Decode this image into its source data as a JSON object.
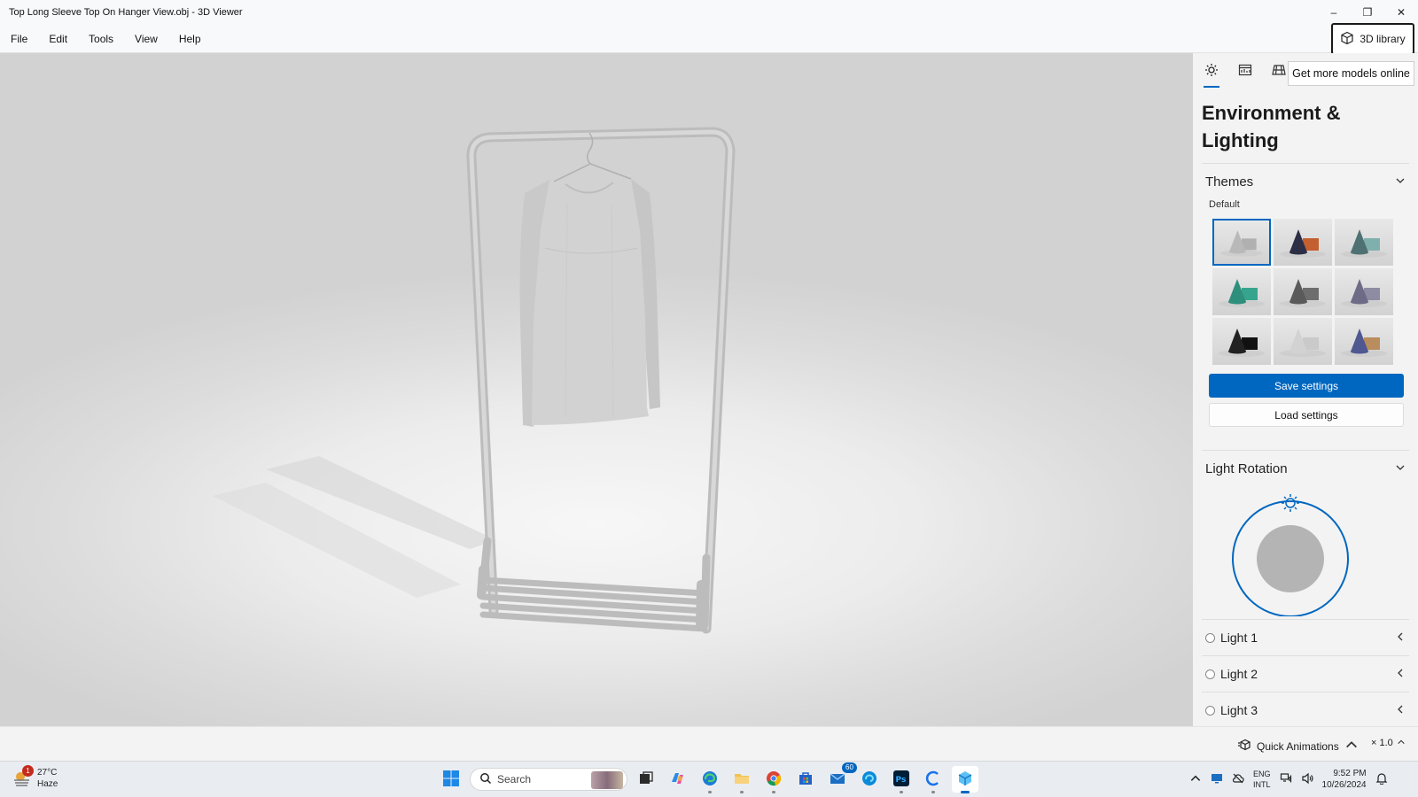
{
  "window": {
    "title": "Top Long Sleeve Top On Hanger View.obj - 3D Viewer",
    "minimize": "–",
    "restore": "❐",
    "close": "✕"
  },
  "menu": {
    "items": [
      "File",
      "Edit",
      "Tools",
      "View",
      "Help"
    ],
    "library_button": "3D library"
  },
  "panel": {
    "tooltip": "Get more models online",
    "title": "Environment & Lighting",
    "themes_label": "Themes",
    "default_label": "Default",
    "themes": [
      {
        "name": "default-gray",
        "cone": "#b9b9b9",
        "box": "#b0b0b0",
        "selected": true
      },
      {
        "name": "dark-orange",
        "cone": "#2c2f45",
        "box": "#c4602f",
        "selected": false
      },
      {
        "name": "teal-gray",
        "cone": "#4f7173",
        "box": "#7fb0ad",
        "selected": false
      },
      {
        "name": "green",
        "cone": "#2f8f7d",
        "box": "#37a58d",
        "selected": false
      },
      {
        "name": "dark-gray",
        "cone": "#5a5a5a",
        "box": "#6e6e6e",
        "selected": false
      },
      {
        "name": "purple-gray",
        "cone": "#6d6b86",
        "box": "#8e8ca3",
        "selected": false
      },
      {
        "name": "black",
        "cone": "#222222",
        "box": "#111111",
        "selected": false
      },
      {
        "name": "light",
        "cone": "#d2d2d2",
        "box": "#cacaca",
        "selected": false
      },
      {
        "name": "blue-gold",
        "cone": "#4f5891",
        "box": "#b98d5d",
        "selected": false
      }
    ],
    "save_settings": "Save settings",
    "load_settings": "Load settings",
    "light_rotation_label": "Light Rotation",
    "lights": [
      "Light 1",
      "Light 2",
      "Light 3"
    ],
    "accent": "#0067c0"
  },
  "statusbar": {
    "quick_animations": "Quick Animations",
    "speed": "× 1.0"
  },
  "taskbar": {
    "weather_badge": "1",
    "temperature": "27°C",
    "condition": "Haze",
    "search_placeholder": "Search",
    "mail_badge": "60",
    "lang_line1": "ENG",
    "lang_line2": "INTL",
    "time": "9:52 PM",
    "date": "10/26/2024"
  }
}
